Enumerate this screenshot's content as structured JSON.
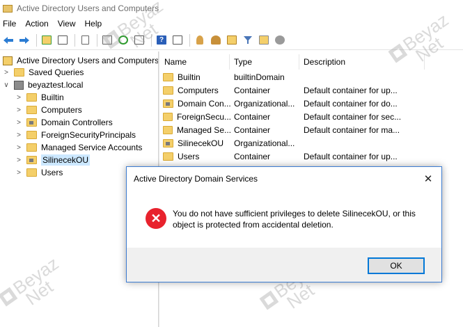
{
  "window": {
    "title": "Active Directory Users and Computers"
  },
  "menu": [
    "File",
    "Action",
    "View",
    "Help"
  ],
  "toolbar": {
    "icons": [
      "back-icon",
      "forward-icon",
      "up-folder-icon",
      "show-tree-icon",
      "copy-icon",
      "export-list-icon",
      "refresh-icon",
      "properties-icon",
      "help-icon",
      "console-icon",
      "create-user-icon",
      "create-group-icon",
      "create-ou-icon",
      "filter-icon",
      "find-icon",
      "add-to-group-icon"
    ]
  },
  "tree": {
    "root": "Active Directory Users and Computers",
    "saved_queries": "Saved Queries",
    "domain": "beyaztest.local",
    "children": [
      "Builtin",
      "Computers",
      "Domain Controllers",
      "ForeignSecurityPrincipals",
      "Managed Service Accounts",
      "SilinecekOU",
      "Users"
    ]
  },
  "list": {
    "columns": [
      "Name",
      "Type",
      "Description"
    ],
    "rows": [
      {
        "name": "Builtin",
        "type": "builtinDomain",
        "description": ""
      },
      {
        "name": "Computers",
        "type": "Container",
        "description": "Default container for up..."
      },
      {
        "name": "Domain Con...",
        "type": "Organizational...",
        "description": "Default container for do..."
      },
      {
        "name": "ForeignSecu...",
        "type": "Container",
        "description": "Default container for sec..."
      },
      {
        "name": "Managed Se...",
        "type": "Container",
        "description": "Default container for ma..."
      },
      {
        "name": "SilinecekOU",
        "type": "Organizational...",
        "description": ""
      },
      {
        "name": "Users",
        "type": "Container",
        "description": "Default container for up..."
      }
    ]
  },
  "dialog": {
    "title": "Active Directory Domain Services",
    "close": "✕",
    "message": "You do not have sufficient privileges to delete SilinecekOU, or this object is protected from accidental deletion.",
    "ok_label": "OK"
  },
  "watermark": {
    "line1": "Beyaz",
    "line2": "Net"
  }
}
